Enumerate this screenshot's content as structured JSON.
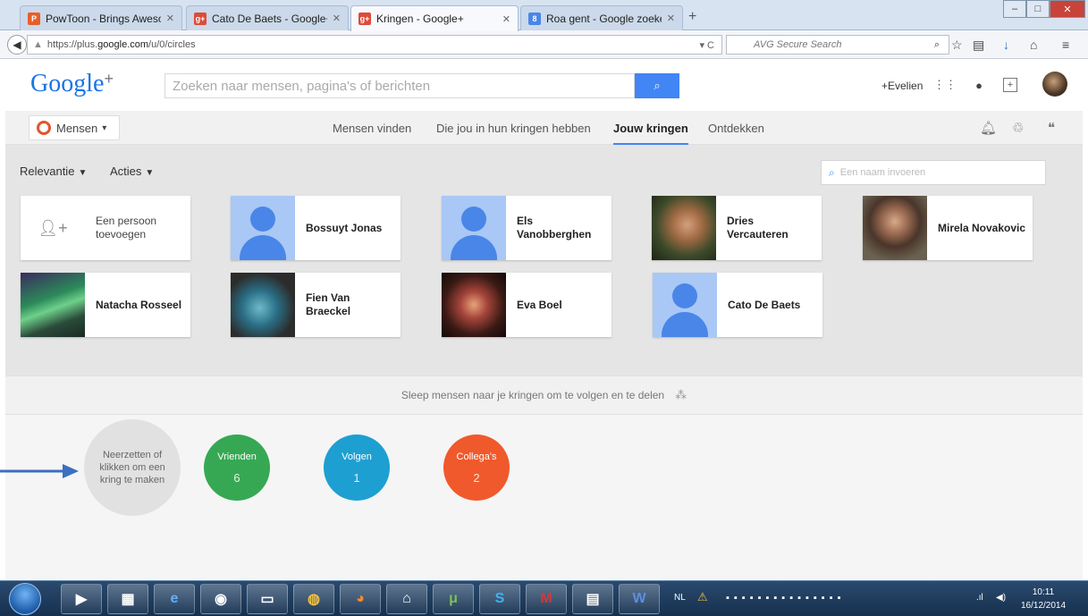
{
  "browser": {
    "tabs": [
      {
        "title": "PowToon - Brings Aweso...",
        "icon": "powtoon-icon",
        "color": "#e85d2a",
        "glyph": "P"
      },
      {
        "title": "Cato De Baets - Google+",
        "icon": "google-plus-icon",
        "color": "#dd4b39",
        "glyph": "g+"
      },
      {
        "title": "Kringen - Google+",
        "icon": "google-plus-icon",
        "color": "#dd4b39",
        "glyph": "g+"
      },
      {
        "title": "Roa gent - Google zoeken",
        "icon": "google-search-icon",
        "color": "#4a86e8",
        "glyph": "8"
      }
    ],
    "new_tab": "+",
    "url_prefix": "https://plus.",
    "url_domain": "google.com",
    "url_path": "/u/0/circles",
    "search_placeholder": "AVG Secure Search"
  },
  "gplus": {
    "logo": "Google",
    "logo_plus": "+",
    "search_placeholder": "Zoeken naar mensen, pagina's of berichten",
    "user": "+Evelien",
    "people_menu": "Mensen",
    "nav_tabs": [
      "Mensen vinden",
      "Die jou in hun kringen hebben",
      "Jouw kringen",
      "Ontdekken"
    ],
    "active_tab": "Jouw kringen",
    "sort_label": "Relevantie",
    "actions_label": "Acties",
    "name_input_placeholder": "Een naam invoeren",
    "add_person_label": "Een persoon toevoegen",
    "people": [
      {
        "name": "Bossuyt Jonas",
        "photo": "default"
      },
      {
        "name": "Els Vanobberghen",
        "photo": "default"
      },
      {
        "name": "Dries Vercauteren",
        "photo": "photo"
      },
      {
        "name": "Mirela Novakovic",
        "photo": "photo"
      },
      {
        "name": "Natacha Rosseel",
        "photo": "photo"
      },
      {
        "name": "Fien Van Braeckel",
        "photo": "photo"
      },
      {
        "name": "Eva Boel",
        "photo": "photo"
      },
      {
        "name": "Cato De Baets",
        "photo": "default"
      }
    ],
    "drag_hint": "Sleep mensen naar je kringen om te volgen en te delen",
    "new_circle_label": "Neerzetten of klikken om een kring te maken",
    "circles": [
      {
        "name": "Vrienden",
        "count": "6",
        "color": "#36a853"
      },
      {
        "name": "Volgen",
        "count": "1",
        "color": "#1e9fd1"
      },
      {
        "name": "Collega's",
        "count": "2",
        "color": "#f0592b"
      }
    ]
  },
  "taskbar": {
    "language": "NL",
    "time": "10:11",
    "date": "16/12/2014"
  }
}
